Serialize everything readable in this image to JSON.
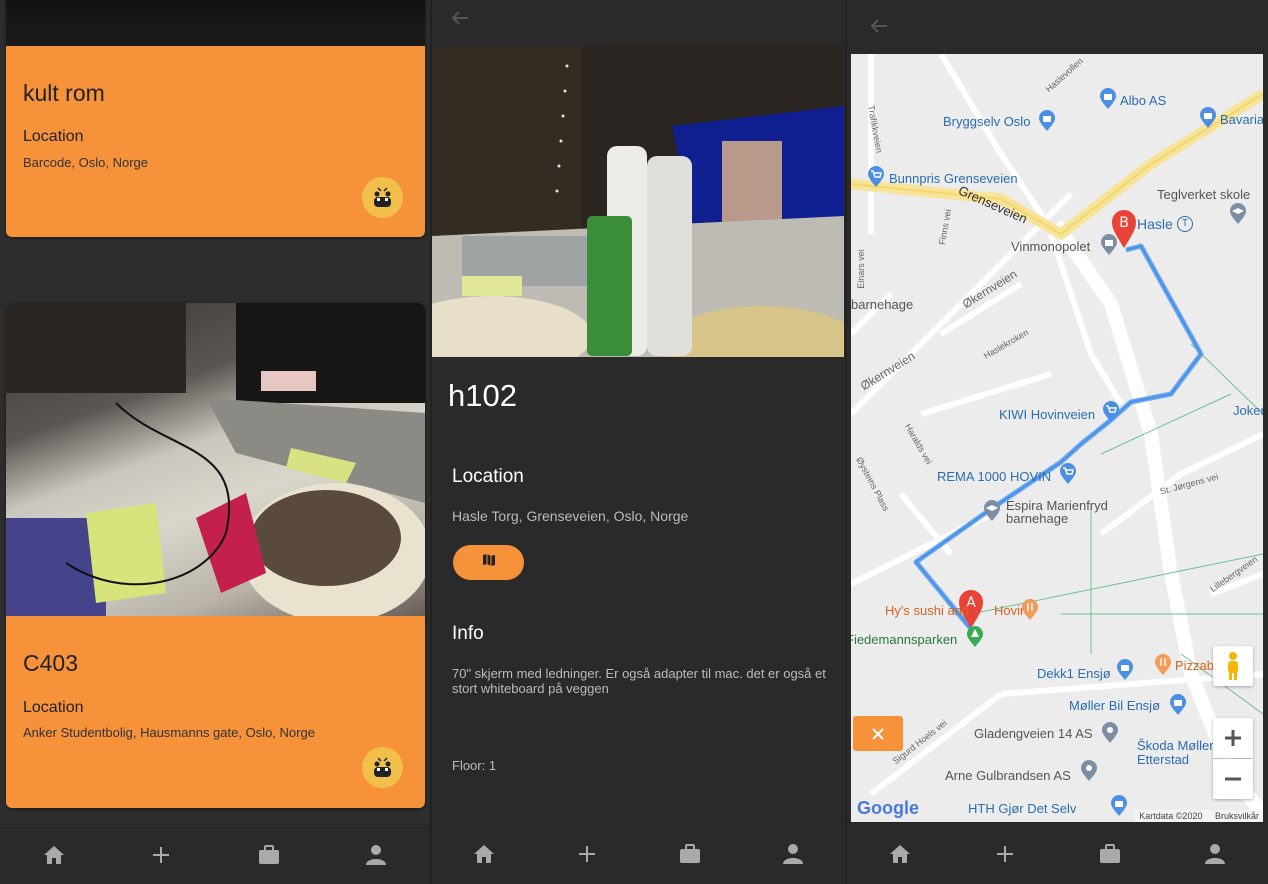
{
  "list_screen": {
    "cards": [
      {
        "title": "kult rom",
        "location_label": "Location",
        "location_value": "Barcode, Oslo, Norge"
      },
      {
        "title": "C403",
        "location_label": "Location",
        "location_value": "Anker Studentbolig, Hausmanns gate, Oslo, Norge"
      }
    ]
  },
  "detail_screen": {
    "title": "h102",
    "location_label": "Location",
    "location_value": "Hasle Torg, Grenseveien, Oslo, Norge",
    "info_label": "Info",
    "info_text": "70\" skjerm med ledninger. Er også adapter til mac. det er også et stort whiteboard på veggen",
    "floor": "Floor: 1"
  },
  "map_screen": {
    "places": {
      "albo": "Albo AS",
      "bryggselv": "Bryggselv Oslo",
      "bavaria": "Bavaria",
      "bunnpris": "Bunnpris Grenseveien",
      "teglverket": "Teglverket skole",
      "hasle": "Hasle",
      "vinmonopolet": "Vinmonopolet",
      "barnehage": "barnehage",
      "kiwi": "KIWI Hovinveien",
      "joker": "Joker H",
      "rema": "REMA 1000 HOVIN",
      "espira": "Espira Marienfryd barnehage",
      "hys": "Hy's sushi and",
      "hovin": "Hovin",
      "fiedemann": "Fiedemannsparken",
      "dekk1": "Dekk1 Ensjø",
      "pizzabakeren": "Pizzab",
      "moller": "Møller Bil Ensjø",
      "gladengveien": "Gladengveien 14 AS",
      "skoda": "Škoda Møller Bil Etterstad",
      "arne": "Arne Gulbrandsen AS",
      "hth": "HTH Gjør Det Selv"
    },
    "roads": {
      "grenseveien": "Grenseveien",
      "okernveien1": "Økernveien",
      "okernveien2": "Økernveien",
      "haslevollen": "Haslevollen",
      "trondheim": "Trafikkveien",
      "finnsvei": "Finns vei",
      "einarsvei": "Einars vei",
      "haslekroken": "Haslekroken",
      "haraldsvei": "Haralds vei",
      "oysteinsplass": "Øysteins Plass",
      "stjorgens": "St. Jørgens vei",
      "lillebergveien": "Lillebergveien",
      "sigurdhoels": "Sigurd Hoels vei"
    },
    "marker_a": "A",
    "marker_b": "B",
    "attribution": "Kartdata ©2020",
    "terms": "Bruksvilkår",
    "google": "Google"
  },
  "colors": {
    "accent": "#f6923a",
    "background": "#2b2b2b",
    "route": "#6aa8f0"
  },
  "nav_icons": [
    "home-icon",
    "add-icon",
    "briefcase-icon",
    "person-icon"
  ]
}
